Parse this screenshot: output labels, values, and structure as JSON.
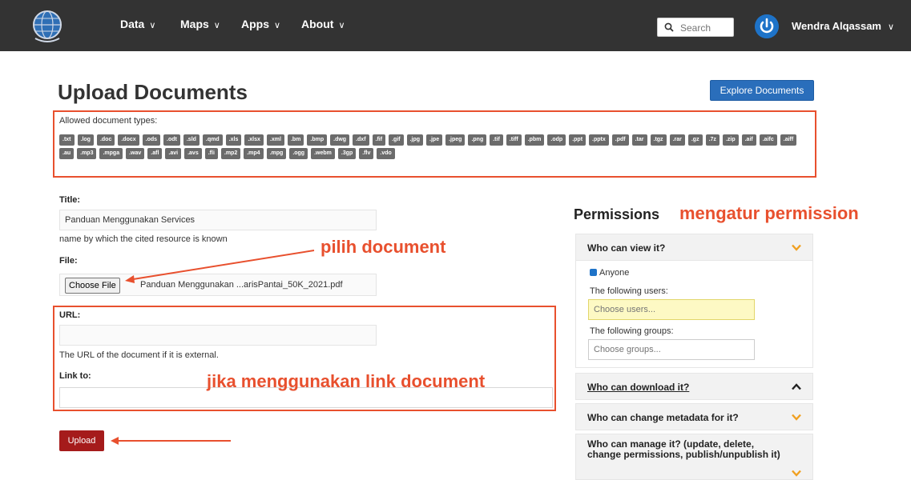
{
  "nav": {
    "items": [
      {
        "label": "Data"
      },
      {
        "label": "Maps"
      },
      {
        "label": "Apps"
      },
      {
        "label": "About"
      }
    ],
    "search_placeholder": "Search",
    "user_name": "Wendra Alqassam"
  },
  "page": {
    "title": "Upload Documents",
    "explore_label": "Explore Documents",
    "allowed_label": "Allowed document types:",
    "doc_types": [
      ".txt",
      ".log",
      ".doc",
      ".docx",
      ".ods",
      ".odt",
      ".sld",
      ".qmd",
      ".xls",
      ".xlsx",
      ".xml",
      ".bm",
      ".bmp",
      ".dwg",
      ".dxf",
      ".fif",
      ".gif",
      ".jpg",
      ".jpe",
      ".jpeg",
      ".png",
      ".tif",
      ".tiff",
      ".pbm",
      ".odp",
      ".ppt",
      ".pptx",
      ".pdf",
      ".tar",
      ".tgz",
      ".rar",
      ".gz",
      ".7z",
      ".zip",
      ".aif",
      ".aifc",
      ".aiff",
      ".au",
      ".mp3",
      ".mpga",
      ".wav",
      ".afl",
      ".avi",
      ".avs",
      ".fli",
      ".mp2",
      ".mp4",
      ".mpg",
      ".ogg",
      ".webm",
      ".3gp",
      ".flv",
      ".vdo"
    ]
  },
  "form": {
    "title_label": "Title:",
    "title_value": "Panduan Menggunakan Services",
    "title_help": "name by which the cited resource is known",
    "file_label": "File:",
    "choose_file_label": "Choose File",
    "file_name": "Panduan Menggunakan ...arisPantai_50K_2021.pdf",
    "url_label": "URL:",
    "url_value": "",
    "url_help": "The URL of the document if it is external.",
    "link_label": "Link to:",
    "link_value": "",
    "upload_label": "Upload"
  },
  "permissions": {
    "title": "Permissions",
    "view_title": "Who can view it?",
    "anyone_label": "Anyone",
    "anyone_checked": true,
    "users_label": "The following users:",
    "users_placeholder": "Choose users...",
    "groups_label": "The following groups:",
    "groups_placeholder": "Choose groups...",
    "download_title": "Who can download it?",
    "metadata_title": "Who can change metadata for it?",
    "manage_title": "Who can manage it? (update, delete, change permissions, publish/unpublish it)"
  },
  "annotations": {
    "permission_note": "mengatur permission",
    "document_note": "pilih document",
    "link_note": "jika menggunakan link document",
    "color": "#e8502e"
  },
  "colors": {
    "navbar": "#333333",
    "primary_button": "#2a6ebb",
    "upload_button": "#a51b1b",
    "chevron_accent": "#f0a020",
    "users_field_highlight": "#fdf9c4"
  }
}
